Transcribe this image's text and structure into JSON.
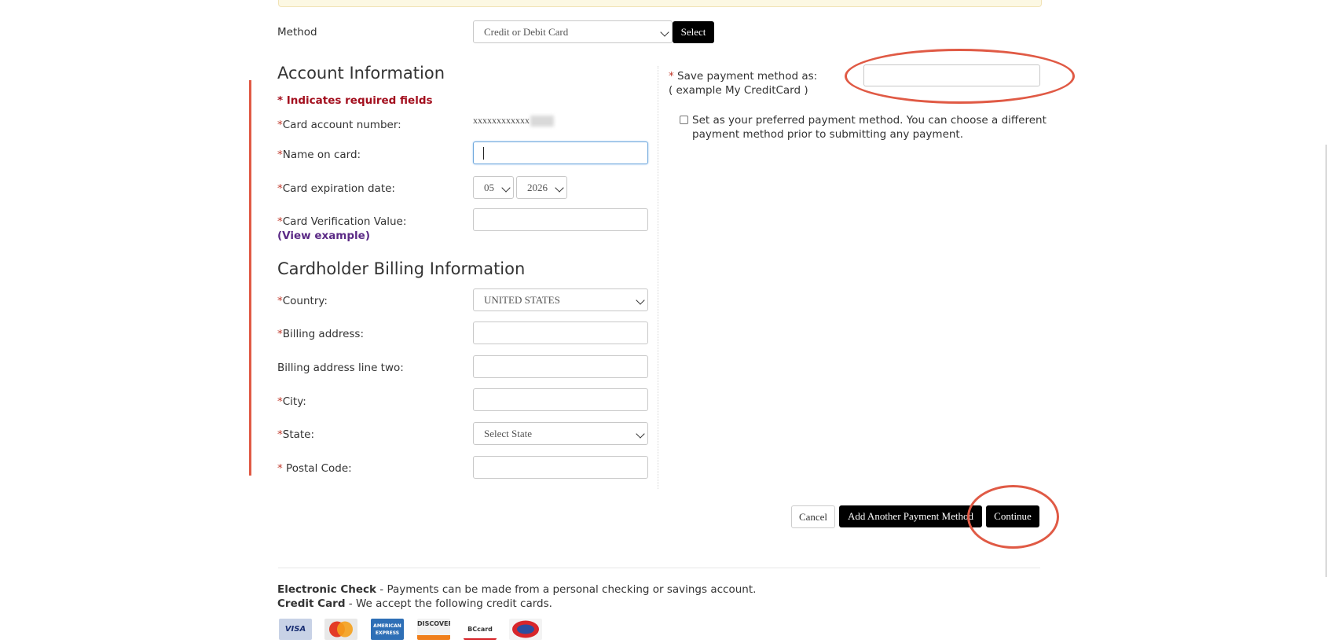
{
  "method": {
    "label": "Method",
    "selected": "Credit or Debit Card",
    "select_button": "Select"
  },
  "account": {
    "heading": "Account Information",
    "required_note": "* Indicates required fields",
    "card_number_label": "Card account number:",
    "card_number_value": "xxxxxxxxxxxx",
    "name_label": "Name on card:",
    "expiration_label": "Card expiration date:",
    "exp_month": "05",
    "exp_year": "2026",
    "cvv_label": "Card Verification Value:",
    "cvv_link": "(View example)"
  },
  "billing": {
    "heading": "Cardholder Billing Information",
    "country_label": "Country:",
    "country_value": "UNITED STATES",
    "address_label": "Billing address:",
    "address2_label": "Billing address line two:",
    "city_label": "City:",
    "state_label": "State:",
    "state_value": "Select State",
    "postal_label": "Postal Code:"
  },
  "save": {
    "label": "Save payment method as:",
    "example": "( example My CreditCard )",
    "preferred_text_1": "Set as your preferred payment method. You can choose a different",
    "preferred_text_2": "payment method prior to submitting any payment."
  },
  "actions": {
    "cancel": "Cancel",
    "add_another": "Add Another Payment Method",
    "continue": "Continue"
  },
  "footer": {
    "echeck_title": "Electronic Check",
    "echeck_text": " - Payments can be made from a personal checking or savings account.",
    "credit_title": "Credit Card",
    "credit_text": " - We accept the following credit cards.",
    "cards": [
      "VISA",
      "MasterCard",
      "AMERICAN EXPRESS",
      "DISCOVER",
      "BCcard",
      "DinaCard"
    ]
  },
  "required_marker": "*"
}
